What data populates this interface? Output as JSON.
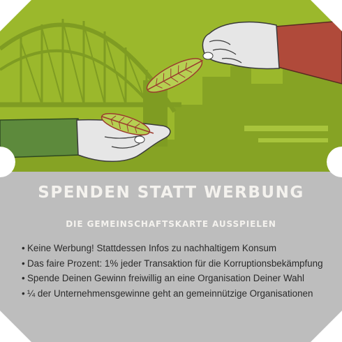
{
  "card": {
    "title": "SPENDEN STATT WERBUNG",
    "subtitle": "DIE GEMEINSCHAFTSKARTE AUSSPIELEN",
    "bullets": [
      "Keine Werbung! Stattdessen Infos zu nachhaltigem Konsum",
      "Das faire Prozent: 1% jeder Transaktion für die Korruptionsbekämpfung",
      "Spende Deinen Gewinn freiwillig an eine Organisation Deiner Wahl",
      "¼ der Unternehmensgewinne geht an gemeinnützige Organisationen"
    ],
    "bullet_symbol": "•"
  },
  "colors": {
    "green": "#9bb82c",
    "green_dark": "#83a023",
    "gray": "#bdbdbd",
    "sleeve_red": "#b04a3a",
    "sleeve_green": "#5d8a3c",
    "hand": "#e6e6e6",
    "leaf": "#9b3b2e"
  },
  "illustration": {
    "elements": [
      "bridge",
      "city-skyline",
      "giving-hand",
      "receiving-hand",
      "leaf"
    ]
  }
}
